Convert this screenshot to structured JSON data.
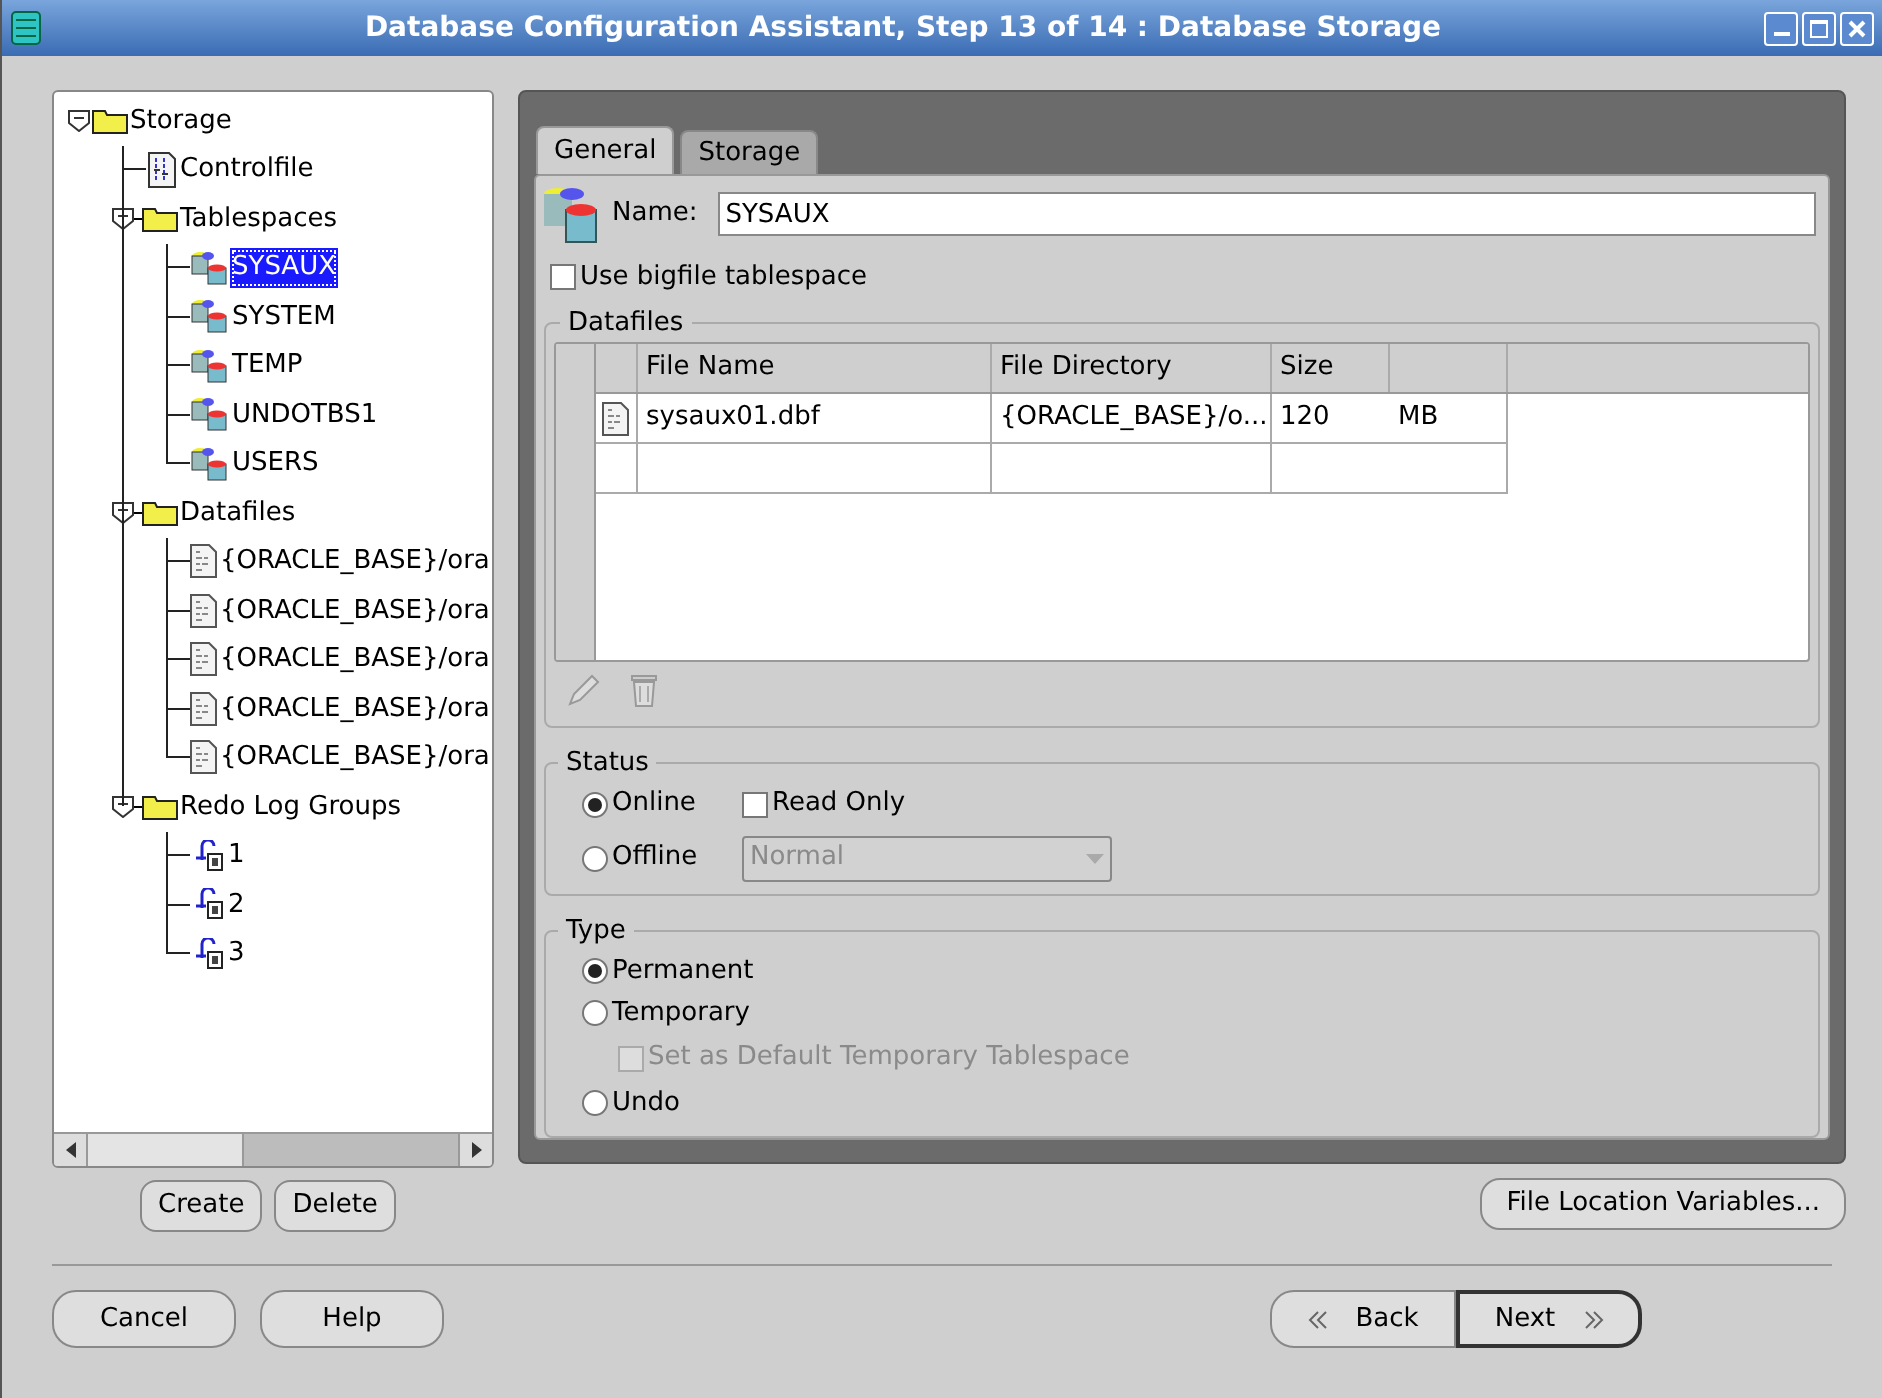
{
  "window": {
    "title": "Database Configuration Assistant, Step 13 of 14 : Database Storage"
  },
  "tree": [
    {
      "label": "Storage",
      "kind": "folder",
      "expanded": true,
      "selected": false,
      "children": [
        {
          "label": "Controlfile",
          "kind": "controlfile",
          "selected": false
        },
        {
          "label": "Tablespaces",
          "kind": "folder",
          "expanded": true,
          "selected": false,
          "children": [
            {
              "label": "SYSAUX",
              "kind": "tablespace",
              "selected": true
            },
            {
              "label": "SYSTEM",
              "kind": "tablespace",
              "selected": false
            },
            {
              "label": "TEMP",
              "kind": "tablespace",
              "selected": false
            },
            {
              "label": "UNDOTBS1",
              "kind": "tablespace",
              "selected": false
            },
            {
              "label": "USERS",
              "kind": "tablespace",
              "selected": false
            }
          ]
        },
        {
          "label": "Datafiles",
          "kind": "folder",
          "expanded": true,
          "selected": false,
          "children": [
            {
              "label": "{ORACLE_BASE}/ora",
              "kind": "datafile",
              "selected": false
            },
            {
              "label": "{ORACLE_BASE}/ora",
              "kind": "datafile",
              "selected": false
            },
            {
              "label": "{ORACLE_BASE}/ora",
              "kind": "datafile",
              "selected": false
            },
            {
              "label": "{ORACLE_BASE}/ora",
              "kind": "datafile",
              "selected": false
            },
            {
              "label": "{ORACLE_BASE}/ora",
              "kind": "datafile",
              "selected": false
            }
          ]
        },
        {
          "label": "Redo Log Groups",
          "kind": "folder",
          "expanded": true,
          "selected": false,
          "children": [
            {
              "label": "1",
              "kind": "redolog",
              "selected": false
            },
            {
              "label": "2",
              "kind": "redolog",
              "selected": false
            },
            {
              "label": "3",
              "kind": "redolog",
              "selected": false
            }
          ]
        }
      ]
    }
  ],
  "tree_buttons": [
    "Create",
    "Delete"
  ],
  "tabs": [
    {
      "label": "General",
      "selected": true
    },
    {
      "label": "Storage",
      "selected": false
    }
  ],
  "name_field": {
    "label": "Name:",
    "value": "SYSAUX"
  },
  "bigfile": {
    "label": "Use bigfile tablespace",
    "checked": false
  },
  "datafiles": {
    "title": "Datafiles",
    "columns": [
      "File Name",
      "File Directory",
      "Size"
    ],
    "rows": [
      {
        "file_name": "sysaux01.dbf",
        "file_directory": "{ORACLE_BASE}/o...",
        "size": "120",
        "unit": "MB"
      }
    ]
  },
  "status": {
    "title": "Status",
    "options": [
      {
        "label": "Online",
        "selected": true
      },
      {
        "label": "Offline",
        "selected": false
      }
    ],
    "read_only": {
      "label": "Read Only",
      "checked": false
    },
    "offline_mode": {
      "value": "Normal",
      "disabled": true
    }
  },
  "type": {
    "title": "Type",
    "options": [
      {
        "label": "Permanent",
        "selected": true
      },
      {
        "label": "Temporary",
        "selected": false,
        "sub_option": {
          "label": "Set as Default Temporary Tablespace",
          "checked": false,
          "disabled": true
        }
      },
      {
        "label": "Undo",
        "selected": false
      }
    ]
  },
  "file_location_button": "File Location Variables...",
  "footer": {
    "left": [
      "Cancel",
      "Help"
    ],
    "back": "Back",
    "next": "Next"
  }
}
